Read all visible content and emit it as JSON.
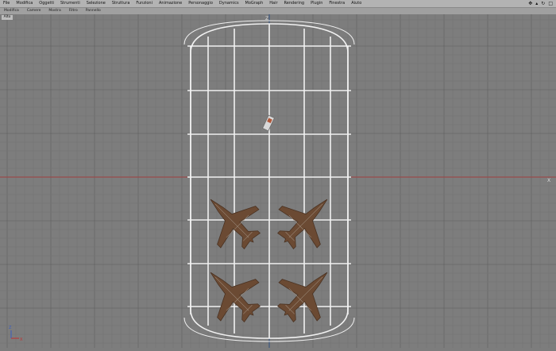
{
  "menubar": {
    "items": [
      "File",
      "Modifica",
      "Oggetti",
      "Strumenti",
      "Selezione",
      "Struttura",
      "Funzioni",
      "Animazione",
      "Personaggio",
      "Dynamics",
      "MoGraph",
      "Hair",
      "Rendering",
      "Plugin",
      "Finestra",
      "Aiuto"
    ],
    "nav_icons": [
      "move-view-icon",
      "zoom-view-icon",
      "rotate-view-icon",
      "maximize-view-icon"
    ]
  },
  "viewbar": {
    "items": [
      "Modifica",
      "Camere",
      "Mostra",
      "Filtro",
      "Pannello"
    ]
  },
  "viewport": {
    "label": "Alto",
    "axis_top": "Z",
    "axis_right": "X",
    "axis_gizmo_x": "X",
    "axis_gizmo_z": "Z",
    "colors": {
      "background": "#7d7d7d",
      "grid_minor": "#747474",
      "grid_major": "#5e5e5e",
      "x_axis": "#a04040",
      "z_axis": "#2f4f7f",
      "wireframe": "#f2f2f2",
      "aircraft": "#6b4a33"
    }
  }
}
